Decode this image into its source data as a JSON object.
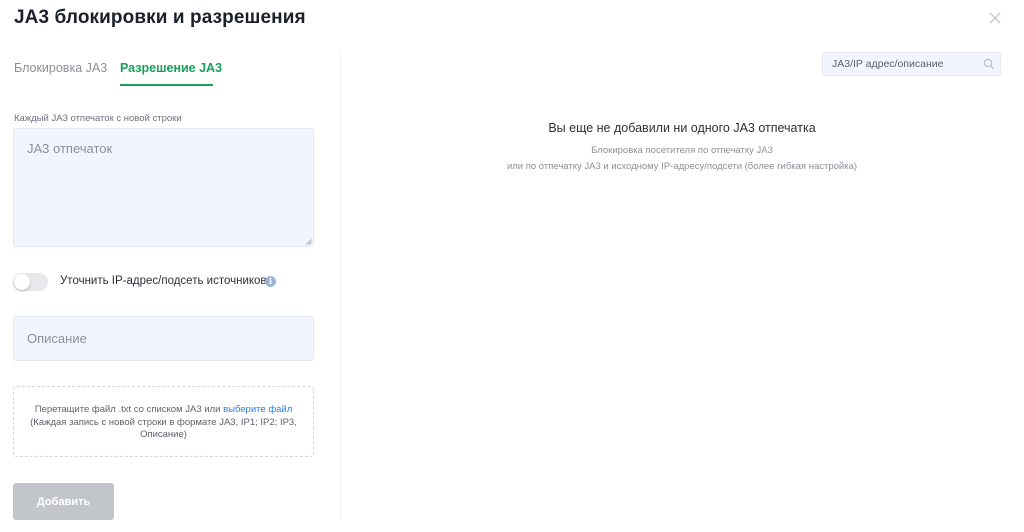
{
  "modal": {
    "title": "JA3 блокировки и разрешения",
    "close_icon": "close-icon"
  },
  "tabs": [
    {
      "label": "Блокировка JA3",
      "active": false
    },
    {
      "label": "Разрешение JA3",
      "active": true
    }
  ],
  "form": {
    "ja3_label": "Каждый JA3 отпечаток с новой строки",
    "ja3_placeholder": "JA3 отпечаток",
    "ja3_value": "",
    "toggle_label": "Уточнить IP-адрес/подсеть источников",
    "toggle_on": false,
    "description_placeholder": "Описание",
    "description_value": "",
    "dropzone": {
      "text_before_link": "Перетащите файл .txt со списком JA3 или ",
      "link_text": "выберите файл",
      "text_after_line1": "(Каждая запись с новой строки в формате JA3, IP1; IP2; IP3,",
      "text_after_line2": "Описание)"
    },
    "add_button_label": "Добавить"
  },
  "search": {
    "placeholder": "JA3/IP адрес/описание",
    "value": ""
  },
  "empty_state": {
    "title": "Вы еще не добавили ни одного JA3 отпечатка",
    "line1": "Блокировка посетителя по отпечатку JA3",
    "line2": "или по отпечатку JA3 и исходному IP-адресу/подсети (более гибкая настройка)"
  },
  "colors": {
    "accent": "#18a058",
    "link": "#2b7de9",
    "input_bg": "#f2f5fe",
    "button_disabled": "#c2c5ca"
  }
}
